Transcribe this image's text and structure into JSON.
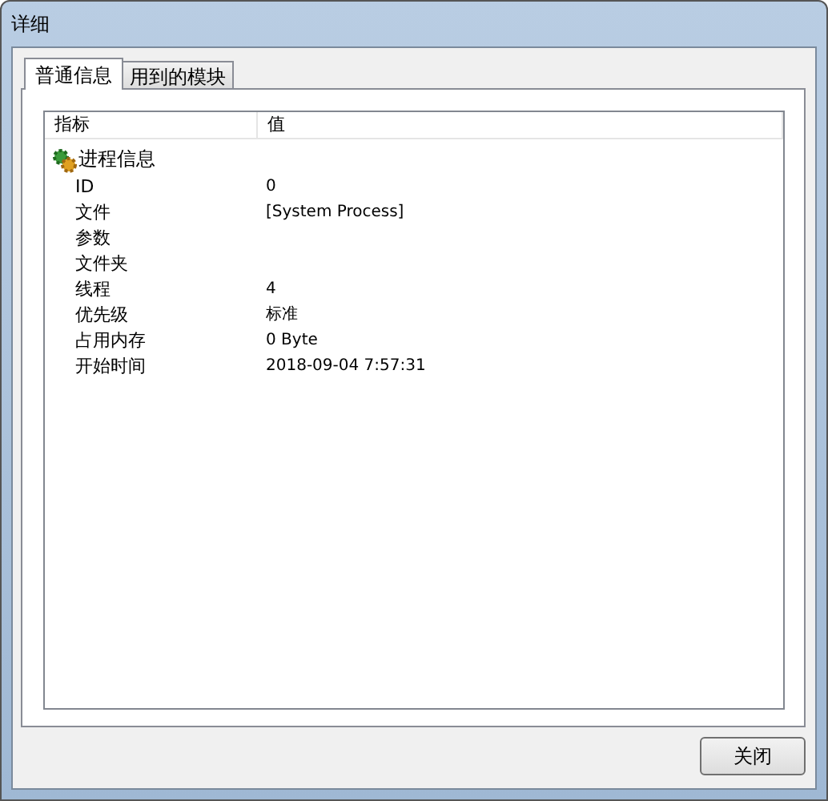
{
  "window": {
    "title": "详细"
  },
  "tabs": [
    {
      "label": "普通信息",
      "selected": true
    },
    {
      "label": "用到的模块",
      "selected": false
    }
  ],
  "list": {
    "columns": [
      "指标",
      "值"
    ],
    "rows": [
      {
        "label": "进程信息",
        "children": [
          {
            "label": "ID",
            "value": "0"
          },
          {
            "label": "文件",
            "value": "[System Process]"
          },
          {
            "label": "参数"
          },
          {
            "label": "文件夹"
          },
          {
            "label": "线程",
            "value": "4"
          },
          {
            "label": "优先级",
            "value": "标准"
          },
          {
            "label": "占用内存",
            "value": "0 Byte"
          },
          {
            "label": "开始时间",
            "value": "2018-09-04 7:57:31"
          }
        ]
      }
    ]
  },
  "buttons": [
    "关闭"
  ]
}
